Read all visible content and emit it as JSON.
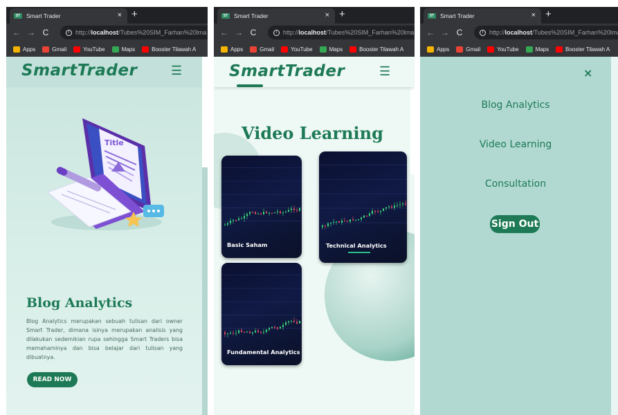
{
  "browser": {
    "tab_title": "Smart Trader",
    "favicon_text": "ST",
    "close_glyph": "×",
    "newtab_glyph": "+",
    "url_prefix": "http://",
    "url_host": "localhost",
    "url_path": "/Tubes%20SIM_Farhan%20lma",
    "bookmarks": [
      {
        "label": "Apps",
        "color": "#f4b400"
      },
      {
        "label": "Gmail",
        "color": "#ea4335"
      },
      {
        "label": "YouTube",
        "color": "#ff0000"
      },
      {
        "label": "Maps",
        "color": "#34a853"
      },
      {
        "label": "Booster Tilawah A",
        "color": "#ff0000"
      }
    ],
    "icons": [
      "back-arrow-icon",
      "forward-arrow-icon",
      "reload-icon",
      "info-icon"
    ]
  },
  "header": {
    "brand": "SmartTrader",
    "menu_icon": "☰"
  },
  "blog": {
    "title": "Blog Analytics",
    "description": "Blog Analytics merupakan sebuah tulisan dari owner Smart Trader, dimana isinya merupakan analisis yang dilakukan sedemikian rupa sehingga Smart Traders bisa memahaminya dan bisa belajar dari tulisan yang dibuatnya.",
    "button": "READ NOW",
    "illustration_word": "Title"
  },
  "video": {
    "title": "Video Learning",
    "cards": [
      {
        "label": "Basic Saham"
      },
      {
        "label": "Technical Analytics"
      },
      {
        "label": "Fundamental Analytics"
      }
    ]
  },
  "menu": {
    "close_glyph": "×",
    "items": [
      "Blog Analytics",
      "Video Learning",
      "Consultation"
    ],
    "signout": "Sign Out"
  },
  "colors": {
    "brand": "#1e7a56",
    "page_bg": "#cfe8e1",
    "menu_bg": "#b1d9d2",
    "chrome": "#35363a"
  }
}
